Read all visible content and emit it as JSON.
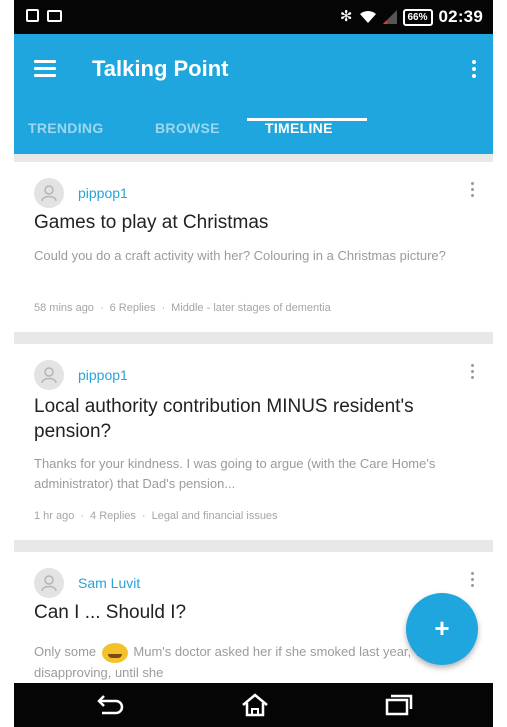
{
  "status_bar": {
    "battery": "66%",
    "time": "02:39"
  },
  "app_bar": {
    "title": "Talking Point",
    "icons": [
      "menu-icon",
      "overflow-menu-icon"
    ]
  },
  "tabs": [
    {
      "label": "TRENDING",
      "active": false
    },
    {
      "label": "BROWSE",
      "active": false
    },
    {
      "label": "TIMELINE",
      "active": true
    }
  ],
  "posts": [
    {
      "author": "pippop1",
      "title": "Games to play at Christmas",
      "body": "Could you do a craft activity with her? Colouring in a Christmas picture?",
      "time": "58 mins ago",
      "replies": "6 Replies",
      "category": "Middle - later stages of dementia"
    },
    {
      "author": "pippop1",
      "title": "Local authority contribution MINUS resident's pension?",
      "body": "Thanks for your kindness. I was going to argue (with the Care Home's administrator) that Dad's pension...",
      "time": "1 hr ago",
      "replies": "4 Replies",
      "category": "Legal and financial issues"
    },
    {
      "author": "Sam Luvit",
      "title": "Can I ... Should I?",
      "body_before": "Only some",
      "body_after": "Mum's doctor asked her if she smoked last year, very disapproving, until she"
    }
  ],
  "fab": {
    "label": "+"
  },
  "colors": {
    "primary": "#1fa6de",
    "author_link": "#29a3d8",
    "title_text": "#222222",
    "muted_text": "#9b9b9b"
  }
}
